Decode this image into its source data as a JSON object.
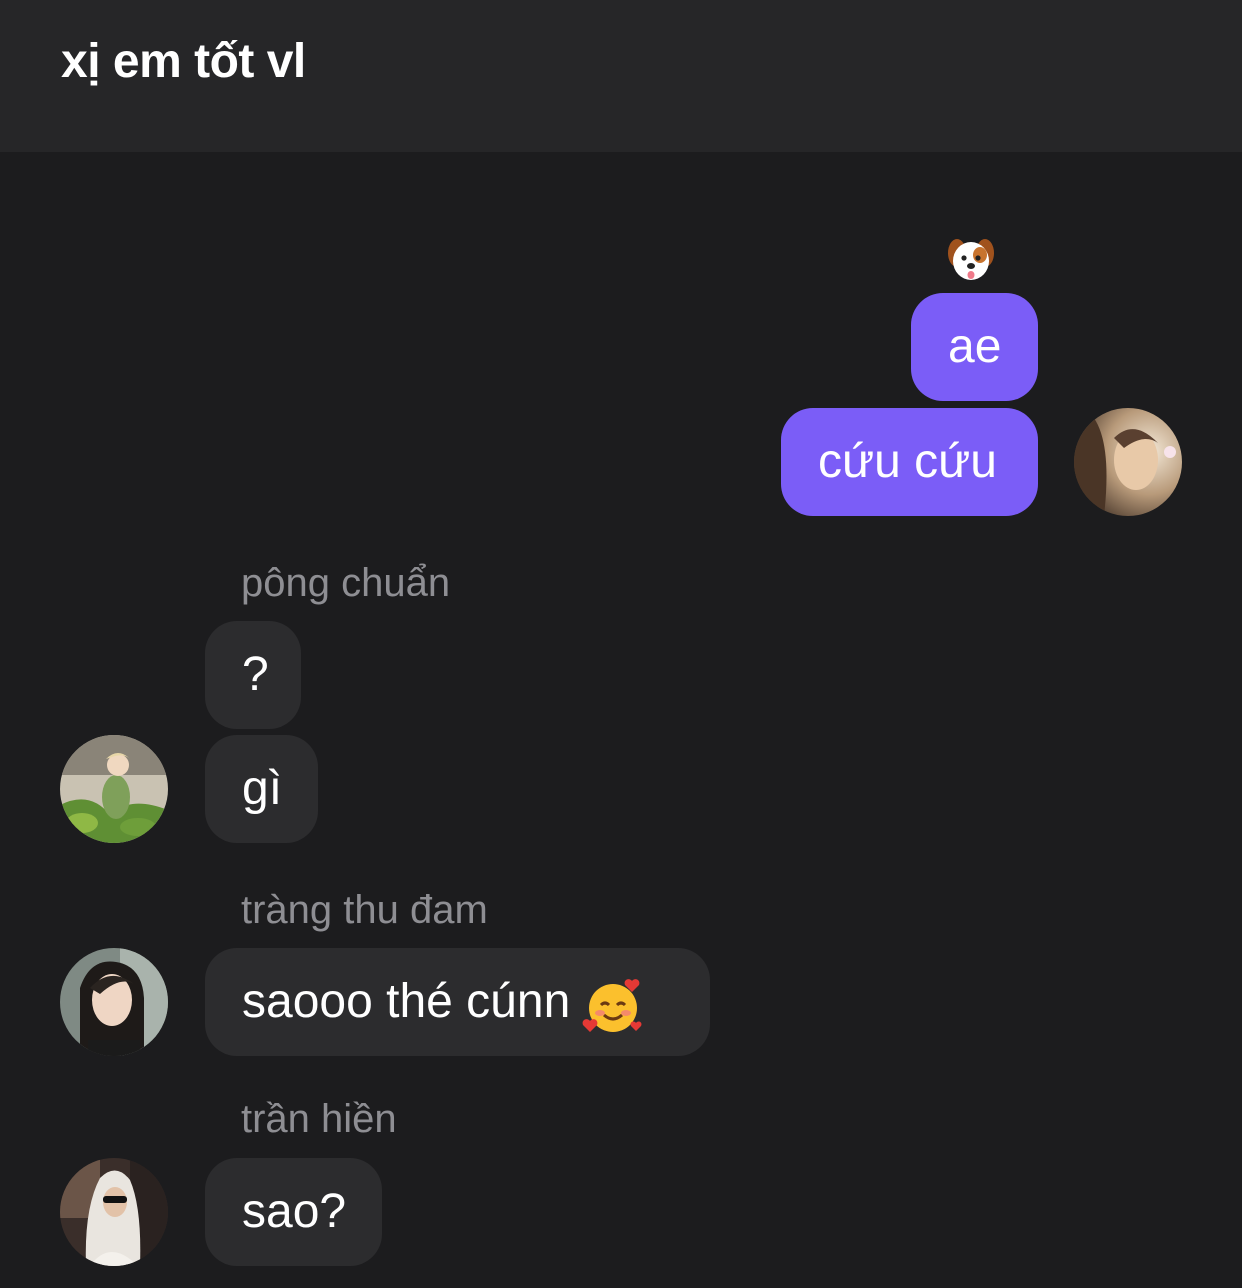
{
  "header": {
    "title": "xị em tốt vl"
  },
  "messages": {
    "outgoing": {
      "reaction_icon": "dog-face-emoji",
      "m1": "ae",
      "m2": "cứu cứu"
    },
    "group1": {
      "sender": "pông chuẩn",
      "m1": "?",
      "m2": "gì"
    },
    "group2": {
      "sender": "tràng thu đam",
      "m1": "saooo thé cúnn",
      "m1_emoji": "smiling-face-with-hearts-emoji"
    },
    "group3": {
      "sender": "trần hiền",
      "m1": "sao?"
    }
  },
  "colors": {
    "background": "#1c1c1e",
    "header": "#262628",
    "outgoing_bubble": "#7b5df7",
    "incoming_bubble": "#2c2c2e",
    "sender_name": "#8e8e93"
  }
}
